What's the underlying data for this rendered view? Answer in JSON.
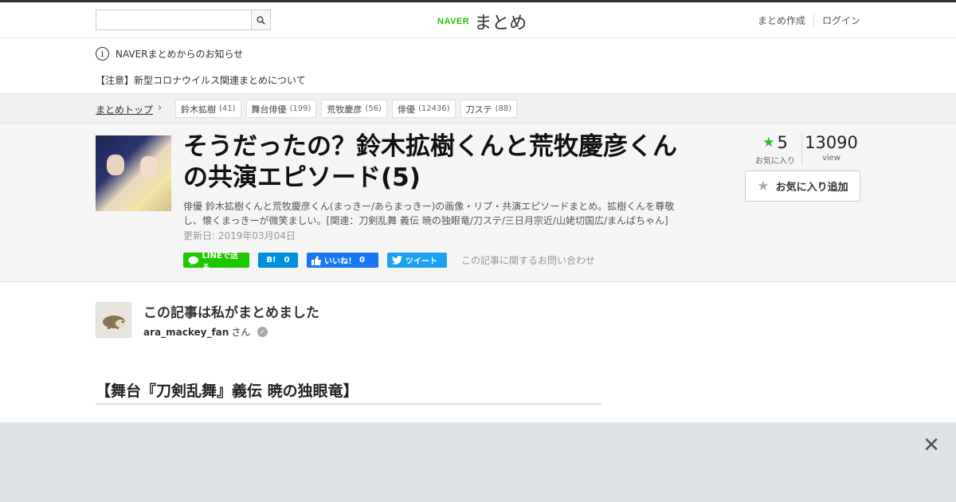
{
  "header": {
    "search_placeholder": "",
    "logo_brand": "NAVER",
    "logo_product": "まとめ",
    "links": [
      "まとめ作成",
      "ログイン"
    ]
  },
  "notice": {
    "title": "NAVERまとめからのお知らせ",
    "item": "【注意】新型コロナウイルス関連まとめについて"
  },
  "breadcrumb": {
    "top": "まとめトップ",
    "tags": [
      {
        "label": "鈴木拡樹",
        "count": "(41)"
      },
      {
        "label": "舞台俳優",
        "count": "(199)"
      },
      {
        "label": "荒牧慶彦",
        "count": "(56)"
      },
      {
        "label": "俳優",
        "count": "(12436)"
      },
      {
        "label": "刀ステ",
        "count": "(88)"
      }
    ]
  },
  "article": {
    "title": "そうだったの？鈴木拡樹くんと荒牧慶彦くんの共演エピソード(5)",
    "description": "俳優 鈴木拡樹くんと荒牧慶彦くん(まっきー/あらまっきー)の画像・リプ・共演エピソードまとめ。拡樹くんを尊敬し、懐くまっきーが微笑ましい。[関連：刀剣乱舞 義伝 暁の独眼竜/刀ステ/三日月宗近/山姥切国広/まんばちゃん]",
    "updated": "更新日: 2019年03月04日",
    "favorites": "5",
    "favorites_label": "お気に入り",
    "views": "13090",
    "views_label": "view",
    "fav_button": "お気に入り追加",
    "share": {
      "line": "LINEで送る",
      "hatena_count": "0",
      "fb": "いいね！",
      "fb_count": "0",
      "tweet": "ツイート",
      "inquiry": "この記事に関するお問い合わせ"
    }
  },
  "author": {
    "heading": "この記事は私がまとめました",
    "name": "ara_mackey_fan",
    "suffix": "さん"
  },
  "section": {
    "heading": "【舞台『刀剣乱舞』義伝 暁の独眼竜】"
  },
  "colors": {
    "naver_green": "#1ec800",
    "star_green": "#2eb82e",
    "hatena_blue": "#008fde",
    "facebook_blue": "#1877f2",
    "twitter_blue": "#1da1f2"
  }
}
